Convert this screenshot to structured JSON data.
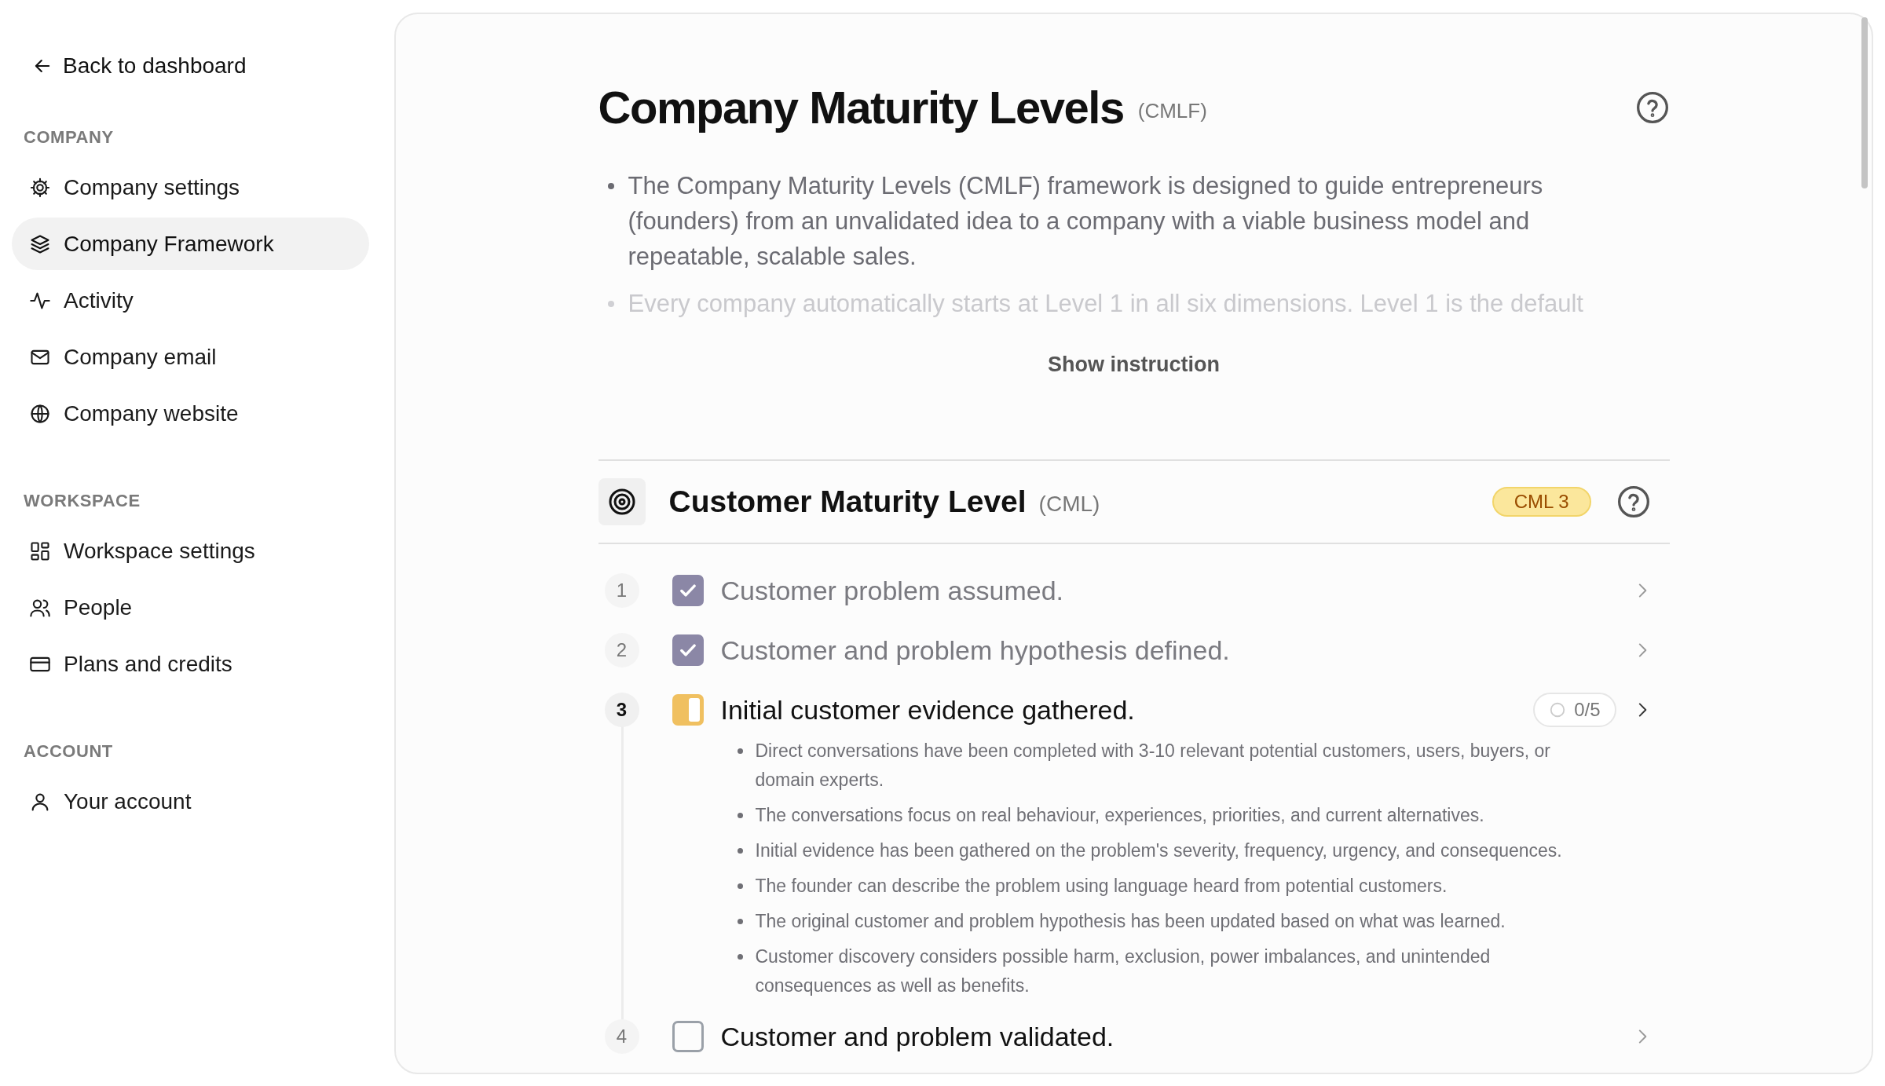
{
  "sidebar": {
    "back_link": "Back to dashboard",
    "sections": [
      {
        "heading": "COMPANY",
        "items": [
          {
            "label": "Company settings",
            "selected": false
          },
          {
            "label": "Company Framework",
            "selected": true
          },
          {
            "label": "Activity",
            "selected": false
          },
          {
            "label": "Company email",
            "selected": false
          },
          {
            "label": "Company website",
            "selected": false
          }
        ]
      },
      {
        "heading": "WORKSPACE",
        "items": [
          {
            "label": "Workspace settings",
            "selected": false
          },
          {
            "label": "People",
            "selected": false
          },
          {
            "label": "Plans and credits",
            "selected": false
          }
        ]
      },
      {
        "heading": "ACCOUNT",
        "items": [
          {
            "label": "Your account",
            "selected": false
          }
        ]
      }
    ]
  },
  "main": {
    "title": "Company Maturity Levels",
    "abbreviation": "(CMLF)",
    "intro": [
      {
        "text": "The Company Maturity Levels (CMLF) framework is designed to guide entrepreneurs (founders) from an unvalidated idea to a company with a viable business model and repeatable, scalable sales.",
        "faded": false
      },
      {
        "text": "Every company automatically starts at Level 1 in all six dimensions. Level 1 is the default",
        "faded": true
      }
    ],
    "show_instruction": "Show instruction",
    "level": {
      "title": "Customer Maturity Level",
      "abbreviation": "(CML)",
      "badge": "CML 3",
      "steps": [
        {
          "number": "1",
          "kind": "done",
          "current": false,
          "text": "Customer problem assumed."
        },
        {
          "number": "2",
          "kind": "done",
          "current": false,
          "text": "Customer and problem hypothesis defined."
        },
        {
          "number": "3",
          "kind": "partial",
          "current": true,
          "text": "Initial customer evidence gathered.",
          "counter": "0/5",
          "criteria": [
            "Direct conversations have been completed with 3-10 relevant potential customers, users, buyers, or domain experts.",
            "The conversations focus on real behaviour, experiences, priorities, and current alternatives.",
            "Initial evidence has been gathered on the problem's severity, frequency, urgency, and consequences.",
            "The founder can describe the problem using language heard from potential customers.",
            "The original customer and problem hypothesis has been updated based on what was learned.",
            "Customer discovery considers possible harm, exclusion, power imbalances, and unintended consequences as well as benefits."
          ]
        },
        {
          "number": "4",
          "kind": "empty",
          "current": false,
          "text": "Customer and problem validated."
        }
      ]
    }
  }
}
